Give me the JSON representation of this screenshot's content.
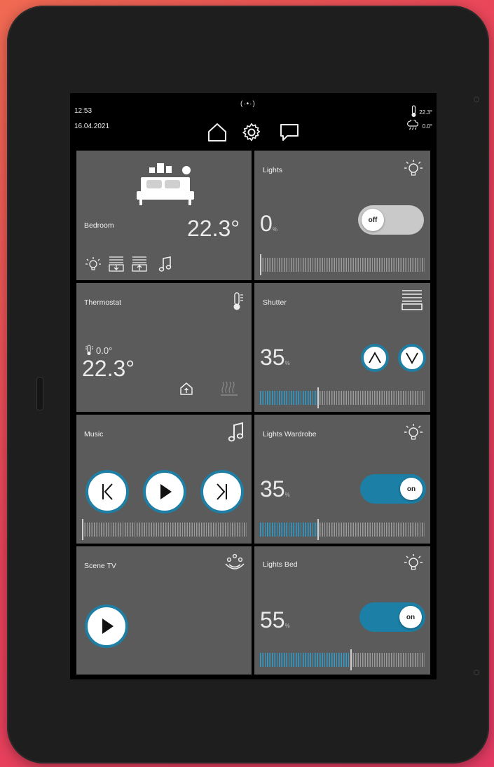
{
  "status": {
    "time": "12:53",
    "date": "16.04.2021",
    "network": "(·•·)",
    "temperature": "22.3°",
    "rain": "0.0°"
  },
  "bedroom": {
    "label": "Bedroom",
    "temperature": "22.3°",
    "shortcuts": [
      "bulb-icon",
      "shutter-down-icon",
      "shutter-up-icon",
      "music-note-icon"
    ]
  },
  "lights": {
    "label": "Lights",
    "value": "0",
    "unit": "%",
    "level": 0,
    "toggle": "off"
  },
  "thermostat": {
    "label": "Thermostat",
    "current": "0.0°",
    "setpoint": "22.3°"
  },
  "shutter": {
    "label": "Shutter",
    "value": "35",
    "unit": "%",
    "level": 35
  },
  "music": {
    "label": "Music",
    "level": 0
  },
  "lights_wardrobe": {
    "label": "Lights Wardrobe",
    "value": "35",
    "unit": "%",
    "level": 35,
    "toggle": "on"
  },
  "scene_tv": {
    "label": "Scene TV"
  },
  "lights_bed": {
    "label": "Lights Bed",
    "value": "55",
    "unit": "%",
    "level": 55,
    "toggle": "on"
  },
  "colors": {
    "accent": "#2d9fcf",
    "toggle_on": "#1b7fa6",
    "toggle_off": "#c9c9c9",
    "tile": "#5b5b5b",
    "background": "#e8425a"
  }
}
